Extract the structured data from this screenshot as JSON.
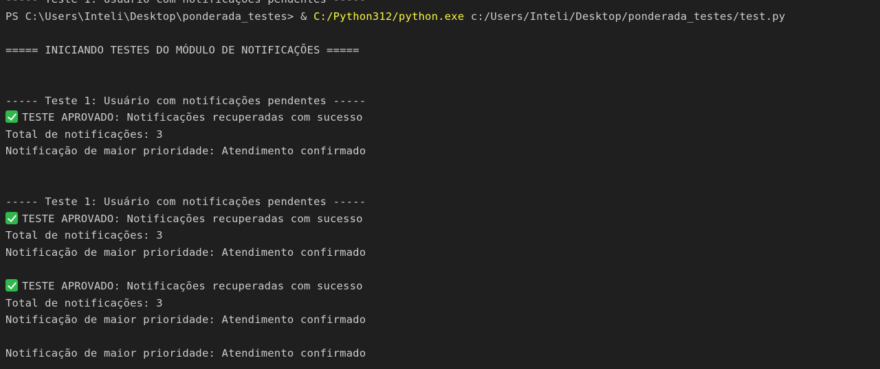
{
  "theme": {
    "background": "#1f1f1f",
    "foreground": "#cccccc",
    "command_color": "#f5f543",
    "success_icon_color": "#2fb84c"
  },
  "terminal": {
    "partial_top_line": "----- Teste 1: Usuário com notificações pendentes -----",
    "prompt": "PS C:\\Users\\Inteli\\Desktop\\ponderada_testes> ",
    "call_operator": "& ",
    "executable": "C:/Python312/python.exe",
    "script_arg": " c:/Users/Inteli/Desktop/ponderada_testes/test.py",
    "header": "===== INICIANDO TESTES DO MÓDULO DE NOTIFICAÇÕES =====",
    "block1": {
      "title": "----- Teste 1: Usuário com notificações pendentes -----",
      "success": "TESTE APROVADO: Notificações recuperadas com sucesso",
      "total": "Total de notificações: 3",
      "priority": "Notificação de maior prioridade: Atendimento confirmado"
    },
    "block2": {
      "title": "----- Teste 1: Usuário com notificações pendentes -----",
      "success": "TESTE APROVADO: Notificações recuperadas com sucesso",
      "total": "Total de notificações: 3",
      "priority": "Notificação de maior prioridade: Atendimento confirmado"
    },
    "block3": {
      "success": "TESTE APROVADO: Notificações recuperadas com sucesso",
      "total": "Total de notificações: 3",
      "priority": "Notificação de maior prioridade: Atendimento confirmado"
    },
    "final_line": "Notificação de maior prioridade: Atendimento confirmado",
    "icons": {
      "success": "check-mark-icon"
    }
  }
}
